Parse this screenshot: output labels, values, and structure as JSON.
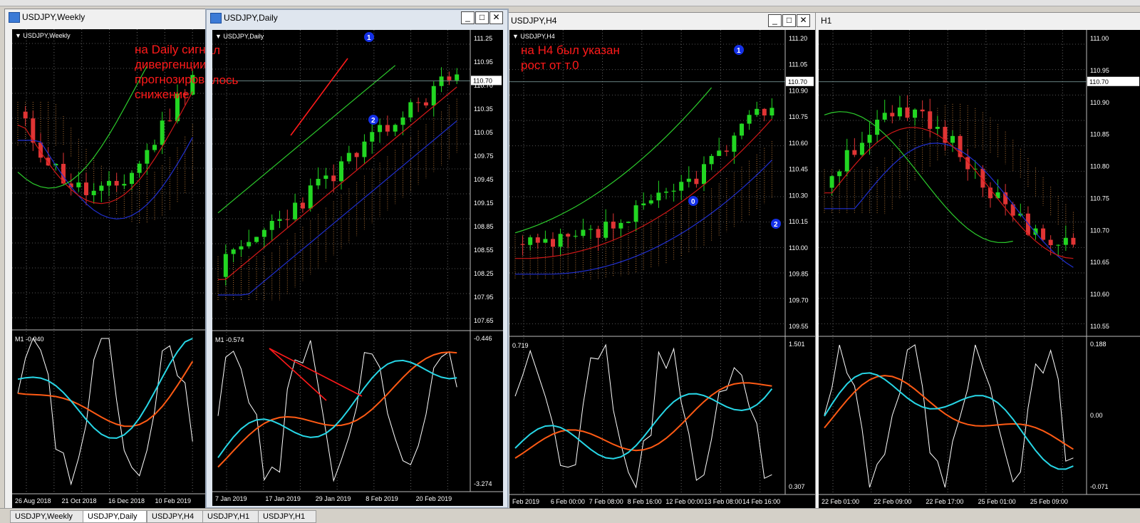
{
  "windows": [
    {
      "id": "weekly",
      "title": "USDJPY,Weekly",
      "chart_label": "USDJPY,Weekly",
      "osc_label": "M1 -0.940",
      "x_labels": [
        "26 Aug 2018",
        "21 Oct 2018",
        "16 Dec 2018",
        "10 Feb 2019"
      ],
      "price_labels": [],
      "osc_labels": []
    },
    {
      "id": "daily",
      "title": "USDJPY,Daily",
      "chart_label": "USDJPY,Daily",
      "osc_label": "M1 -0.574",
      "x_labels": [
        "7 Jan 2019",
        "17 Jan 2019",
        "29 Jan 2019",
        "8 Feb 2019",
        "20 Feb 2019"
      ],
      "price_labels": [
        "111.25",
        "110.95",
        "110.70",
        "110.35",
        "110.05",
        "109.75",
        "109.45",
        "109.15",
        "108.85",
        "108.55",
        "108.25",
        "107.95",
        "107.65"
      ],
      "current_price": "110.70",
      "osc_labels": [
        "-0.446",
        "-3.274"
      ],
      "annotation": "на Daily сигнал\nдивергенции\nпрогнозировалось\nснижение",
      "markers": [
        "1",
        "2"
      ]
    },
    {
      "id": "h4",
      "title": "USDJPY,H4",
      "chart_label": "USDJPY,H4",
      "osc_label": "0.719",
      "x_labels": [
        "Feb 2019",
        "6 Feb 00:00",
        "7 Feb 08:00",
        "8 Feb 16:00",
        "12 Feb 00:00",
        "13 Feb 08:00",
        "14 Feb 16:00"
      ],
      "price_labels": [
        "111.20",
        "111.05",
        "110.90",
        "110.75",
        "110.60",
        "110.45",
        "110.30",
        "110.15",
        "110.00",
        "109.85",
        "109.70",
        "109.55"
      ],
      "current_price": "110.70",
      "osc_labels": [
        "1.501",
        "0.307"
      ],
      "annotation": "на H4 был указан\nрост от т.0",
      "markers": [
        "1",
        "0",
        "2"
      ]
    },
    {
      "id": "h1",
      "title": "H1",
      "chart_label": "",
      "osc_label": "",
      "x_labels": [
        "22 Feb 01:00",
        "22 Feb 09:00",
        "22 Feb 17:00",
        "25 Feb 01:00",
        "25 Feb 09:00"
      ],
      "price_labels": [
        "111.00",
        "110.95",
        "110.90",
        "110.85",
        "110.80",
        "110.75",
        "110.70",
        "110.65",
        "110.60",
        "110.55"
      ],
      "current_price": "110.70",
      "osc_labels": [
        "0.188",
        "0.00",
        "-0.071"
      ]
    }
  ],
  "tabs": [
    "USDJPY,Weekly",
    "USDJPY,Daily",
    "USDJPY,H4",
    "USDJPY,H1",
    "USDJPY,H1"
  ],
  "chart_data": [
    {
      "type": "line",
      "title": "USDJPY,Weekly",
      "x": [
        "26 Aug 2018",
        "21 Oct 2018",
        "16 Dec 2018",
        "10 Feb 2019"
      ]
    },
    {
      "type": "line",
      "title": "USDJPY,Daily",
      "ylim": [
        107.65,
        111.25
      ],
      "x": [
        "7 Jan 2019",
        "17 Jan 2019",
        "29 Jan 2019",
        "8 Feb 2019",
        "20 Feb 2019"
      ]
    },
    {
      "type": "line",
      "title": "USDJPY,H4",
      "ylim": [
        109.55,
        111.2
      ],
      "x": [
        "6 Feb 00:00",
        "7 Feb 08:00",
        "8 Feb 16:00",
        "12 Feb 00:00",
        "13 Feb 08:00",
        "14 Feb 16:00"
      ]
    },
    {
      "type": "line",
      "title": "H1",
      "ylim": [
        110.55,
        111.0
      ],
      "x": [
        "22 Feb 01:00",
        "22 Feb 09:00",
        "22 Feb 17:00",
        "25 Feb 01:00",
        "25 Feb 09:00"
      ]
    }
  ],
  "colors": {
    "bull": "#22d622",
    "bear": "#e03434",
    "tenkan": "#d01818",
    "kijun": "#2030d0",
    "chikou": "#2ccc2c",
    "cloud": "#e09040",
    "osc_white": "#ffffff",
    "osc_cyan": "#27d7e7",
    "osc_orange": "#ff5a14",
    "annot": "#ff1a1a",
    "marker": "#1430e6"
  }
}
